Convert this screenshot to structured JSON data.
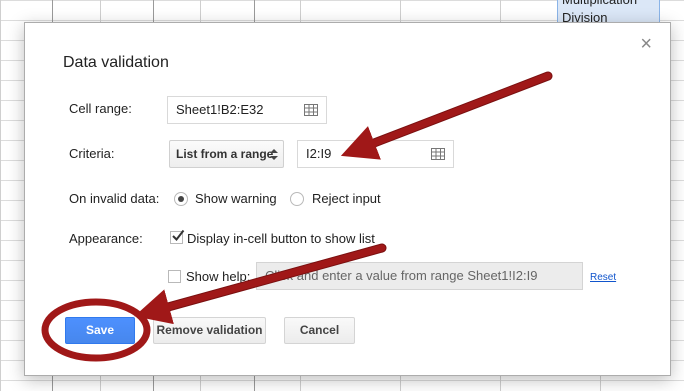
{
  "background": {
    "list_items": [
      "Multiplication",
      "Division"
    ]
  },
  "dialog": {
    "title": "Data validation",
    "close_symbol": "×",
    "cell_range": {
      "label": "Cell range:",
      "value": "Sheet1!B2:E32"
    },
    "criteria": {
      "label": "Criteria:",
      "type": "List from a range",
      "value": "I2:I9"
    },
    "on_invalid": {
      "label": "On invalid data:",
      "options": [
        "Show warning",
        "Reject input"
      ],
      "selected": "Show warning"
    },
    "appearance": {
      "label": "Appearance:",
      "display_button": {
        "label": "Display in-cell button to show list",
        "checked": true
      },
      "show_help": {
        "label": "Show help:",
        "checked": false,
        "placeholder": "Click and enter a value from range Sheet1!I2:I9",
        "reset_label": "Reset"
      }
    },
    "buttons": {
      "save": "Save",
      "remove": "Remove validation",
      "cancel": "Cancel"
    }
  },
  "colors": {
    "primary_button": "#4787ed",
    "annotation_red": "#a01818",
    "link": "#1155cc"
  },
  "icons": [
    "grid-icon",
    "close-icon",
    "updown-arrow-icon",
    "radio-icon",
    "checkbox-icon"
  ]
}
